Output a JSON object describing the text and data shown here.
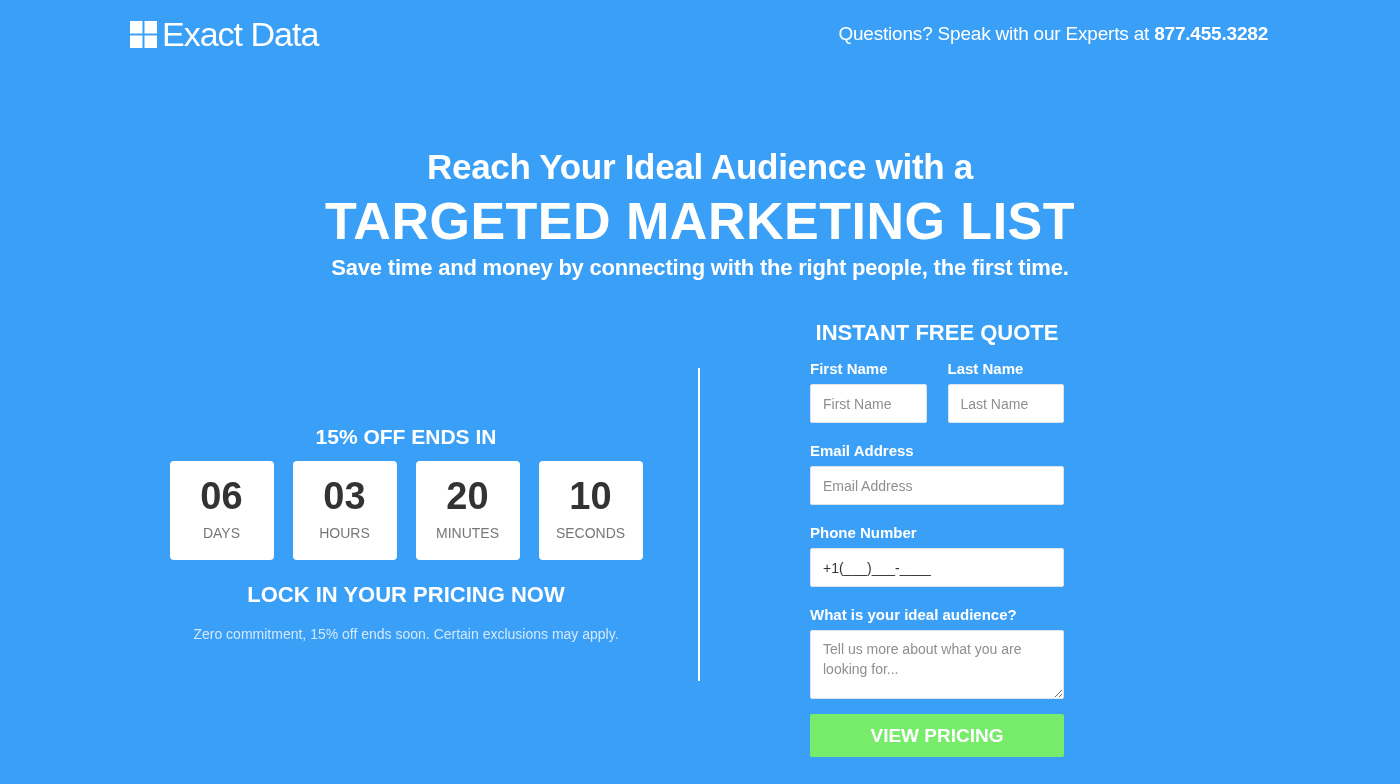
{
  "header": {
    "logo": "Exact Data",
    "contact": "Questions? Speak with our Experts at **877.455.3282**"
  },
  "hero": {
    "intro": "Reach Your Ideal Audience with a",
    "headline": "TARGETED MARKETING LIST",
    "subheadline": "Save time and money by connecting with the right people, the first time."
  },
  "offer": {
    "title": "15% OFF ENDS IN",
    "countdown": [
      {
        "value": "06",
        "unit": "DAYS"
      },
      {
        "value": "03",
        "unit": "HOURS"
      },
      {
        "value": "20",
        "unit": "MINUTES"
      },
      {
        "value": "10",
        "unit": "SECONDS"
      }
    ],
    "heading": "LOCK IN YOUR PRICING NOW",
    "note": "Zero commitment, 15% off ends soon. Certain exclusions may apply."
  },
  "quote_form": {
    "title": "INSTANT FREE QUOTE",
    "rows": [
      [
        {
          "kind": "input",
          "label": "First Name",
          "placeholder": "First Name"
        },
        {
          "kind": "input",
          "label": "Last Name",
          "placeholder": "Last Name"
        }
      ],
      [
        {
          "kind": "input",
          "label": "Email Address",
          "placeholder": "Email Address"
        }
      ],
      [
        {
          "kind": "input",
          "label": "Phone Number",
          "value": "+1(___)___-____"
        }
      ],
      [
        {
          "kind": "textarea",
          "label": "What is your ideal audience?",
          "placeholder": "Tell us more about what you are looking for..."
        }
      ]
    ],
    "submit": "VIEW PRICING"
  }
}
